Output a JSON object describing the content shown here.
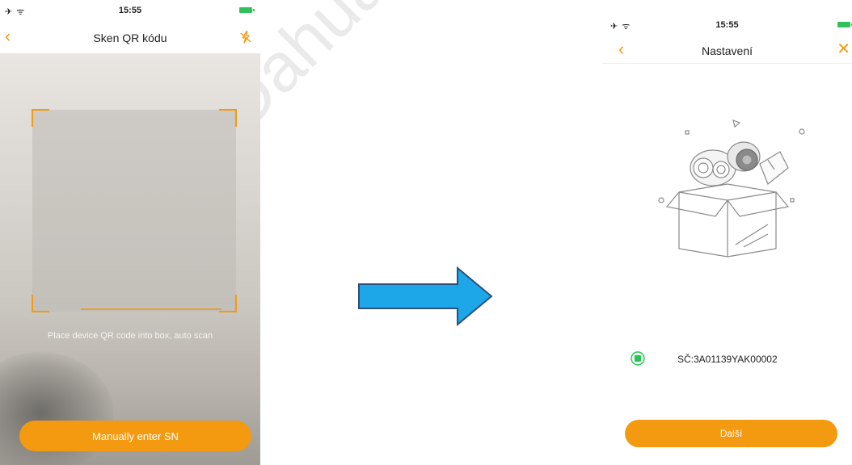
{
  "watermark": {
    "text": "Dahua hua"
  },
  "left_screen": {
    "status": {
      "left_icons": "✈ ᯤ",
      "time": "15:55"
    },
    "nav": {
      "back_glyph": "‹",
      "title": "Sken QR kódu",
      "flash_icon": "flash-off-icon"
    },
    "scan": {
      "hint": "Place device QR code into box, auto scan"
    },
    "manual_button": "Manually enter SN"
  },
  "right_screen": {
    "status": {
      "left_icons": "✈ ᯤ",
      "time": "15:55"
    },
    "nav": {
      "back_glyph": "‹",
      "title": "Nastavení",
      "close_glyph": "✕"
    },
    "device": {
      "sn": "SČ:3A01139YAK00002",
      "device_icon": "camera-device-icon"
    },
    "next_button": "Další"
  },
  "colors": {
    "accent": "#f39a11",
    "arrow": "#1ea7e8",
    "battery": "#2fc25b"
  }
}
